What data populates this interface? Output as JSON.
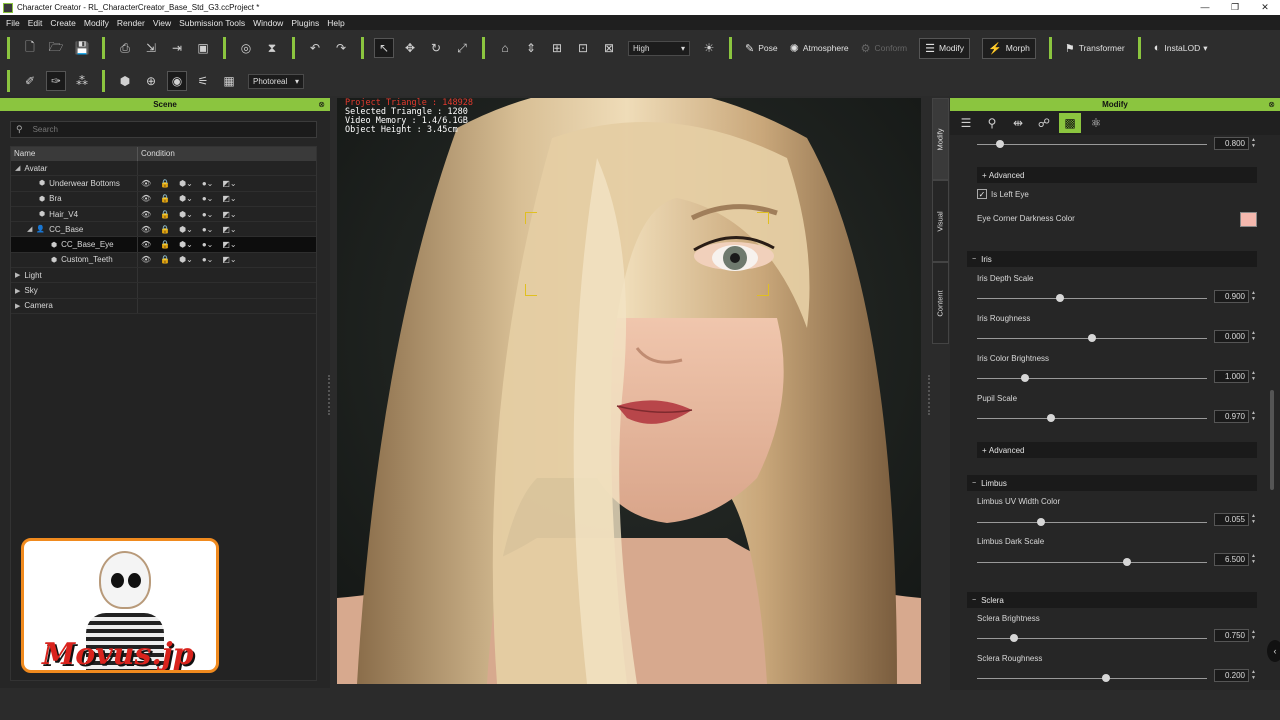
{
  "window": {
    "title": "Character Creator - RL_CharacterCreator_Base_Std_G3.ccProject *",
    "controls": [
      "—",
      "❐",
      "✕"
    ]
  },
  "menu": [
    "File",
    "Edit",
    "Create",
    "Modify",
    "Render",
    "View",
    "Submission Tools",
    "Window",
    "Plugins",
    "Help"
  ],
  "toolbar": {
    "quality": "High",
    "pose": "Pose",
    "atmosphere": "Atmosphere",
    "conform": "Conform",
    "modify": "Modify",
    "morph": "Morph",
    "transformer": "Transformer",
    "instalod": "InstaLOD",
    "render_mode": "Photoreal"
  },
  "scene": {
    "title": "Scene",
    "search_placeholder": "Search",
    "col_name": "Name",
    "col_condition": "Condition",
    "items": [
      {
        "label": "Avatar",
        "indent": 0,
        "expanded": true
      },
      {
        "label": "Underwear Bottoms",
        "indent": 2
      },
      {
        "label": "Bra",
        "indent": 2
      },
      {
        "label": "Hair_V4",
        "indent": 2
      },
      {
        "label": "CC_Base",
        "indent": 1,
        "expanded": true
      },
      {
        "label": "CC_Base_Eye",
        "indent": 3,
        "selected": true
      },
      {
        "label": "Custom_Teeth",
        "indent": 3
      },
      {
        "label": "Light",
        "indent": 0,
        "expanded": false
      },
      {
        "label": "Sky",
        "indent": 0,
        "expanded": false
      },
      {
        "label": "Camera",
        "indent": 0,
        "expanded": false
      }
    ]
  },
  "watermark": {
    "text": "Movus.jp"
  },
  "viewport": {
    "project_triangle": "Project Triangle : 148928",
    "selected_triangle": "Selected Triangle : 1280",
    "video_memory": "Video Memory : 1.4/6.1GB",
    "object_height": "Object Height : 3.45cm"
  },
  "side_tabs": [
    "Modify",
    "Visual",
    "Content"
  ],
  "modify": {
    "title": "Modify",
    "top_value": "0.800",
    "advanced_1": "Advanced",
    "is_left_eye": "Is Left Eye",
    "eye_corner_darkness": "Eye Corner Darkness Color",
    "eye_corner_color": "#f4b8ae",
    "iris_section": "Iris",
    "iris_depth_scale": "Iris Depth Scale",
    "iris_depth_value": "0.900",
    "iris_roughness": "Iris Roughness",
    "iris_roughness_value": "0.000",
    "iris_color_brightness": "Iris Color Brightness",
    "iris_color_brightness_value": "1.000",
    "pupil_scale": "Pupil Scale",
    "pupil_scale_value": "0.970",
    "advanced_2": "Advanced",
    "limbus_section": "Limbus",
    "limbus_uv_width": "Limbus UV Width Color",
    "limbus_uv_width_value": "0.055",
    "limbus_dark_scale": "Limbus Dark Scale",
    "limbus_dark_scale_value": "6.500",
    "sclera_section": "Sclera",
    "sclera_brightness": "Sclera Brightness",
    "sclera_brightness_value": "0.750",
    "sclera_roughness": "Sclera Roughness",
    "sclera_roughness_value": "0.200"
  },
  "slider_levels": {
    "top": 0.1,
    "iris_depth": 0.36,
    "iris_roughness": 0.5,
    "iris_color_brightness": 0.21,
    "pupil_scale": 0.32,
    "limbus_uv_width": 0.28,
    "limbus_dark_scale": 0.65,
    "sclera_brightness": 0.16,
    "sclera_roughness": 0.56
  },
  "colors": {
    "accent": "#8bc53f",
    "highlight": "#e0c020",
    "stat_alert": "#e23a2e"
  }
}
